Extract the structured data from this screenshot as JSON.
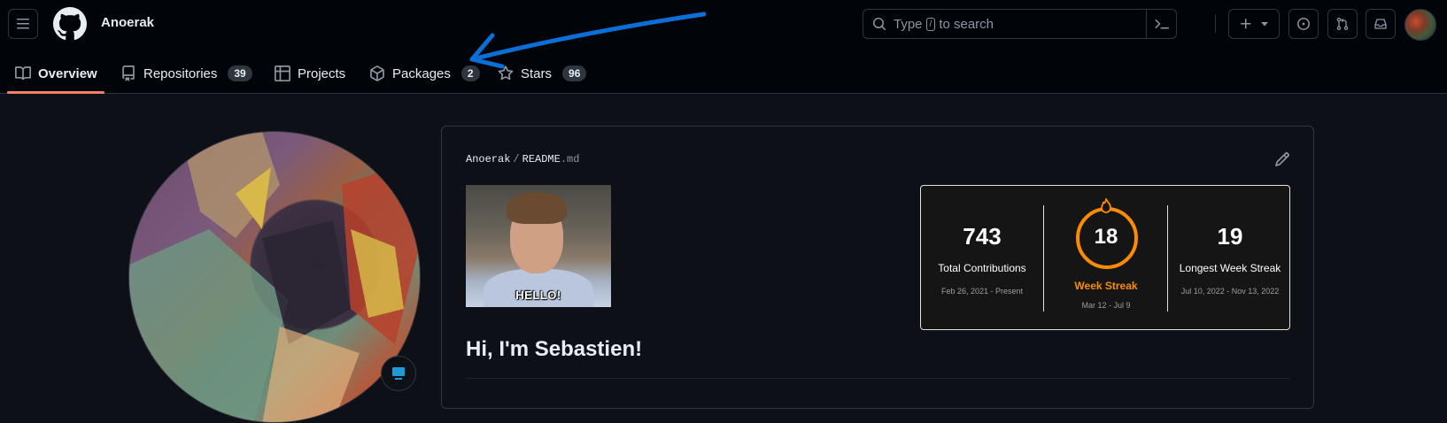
{
  "header": {
    "owner": "Anoerak",
    "search": {
      "prefix": "Type",
      "key": "/",
      "suffix": "to search"
    },
    "icons": [
      "menu-icon",
      "github-logo-icon",
      "search-icon",
      "terminal-icon",
      "plus-icon",
      "chevron-down-icon",
      "issues-icon",
      "pull-request-icon",
      "inbox-icon"
    ]
  },
  "tabs": [
    {
      "label": "Overview",
      "count": "",
      "icon": "book-icon",
      "active": true
    },
    {
      "label": "Repositories",
      "count": "39",
      "icon": "repo-icon"
    },
    {
      "label": "Projects",
      "count": "",
      "icon": "table-icon"
    },
    {
      "label": "Packages",
      "count": "2",
      "icon": "package-icon"
    },
    {
      "label": "Stars",
      "count": "96",
      "icon": "star-icon"
    }
  ],
  "readme": {
    "owner": "Anoerak",
    "file": "README",
    "ext": ".md",
    "gif_caption": "HELLO!",
    "heading": "Hi, I'm Sebastien!"
  },
  "streak": {
    "total": {
      "value": "743",
      "label": "Total Contributions",
      "range": "Feb 26, 2021 - Present"
    },
    "current": {
      "value": "18",
      "label": "Week Streak",
      "range": "Mar 12 - Jul 9"
    },
    "longest": {
      "value": "19",
      "label": "Longest Week Streak",
      "range": "Jul 10, 2022 - Nov 13, 2022"
    }
  },
  "colors": {
    "header_bg": "#010409",
    "page_bg": "#0d1117",
    "tab_underline": "#f78166",
    "streak_orange": "#fb8c00",
    "annotation_arrow": "#0a6fd6"
  }
}
